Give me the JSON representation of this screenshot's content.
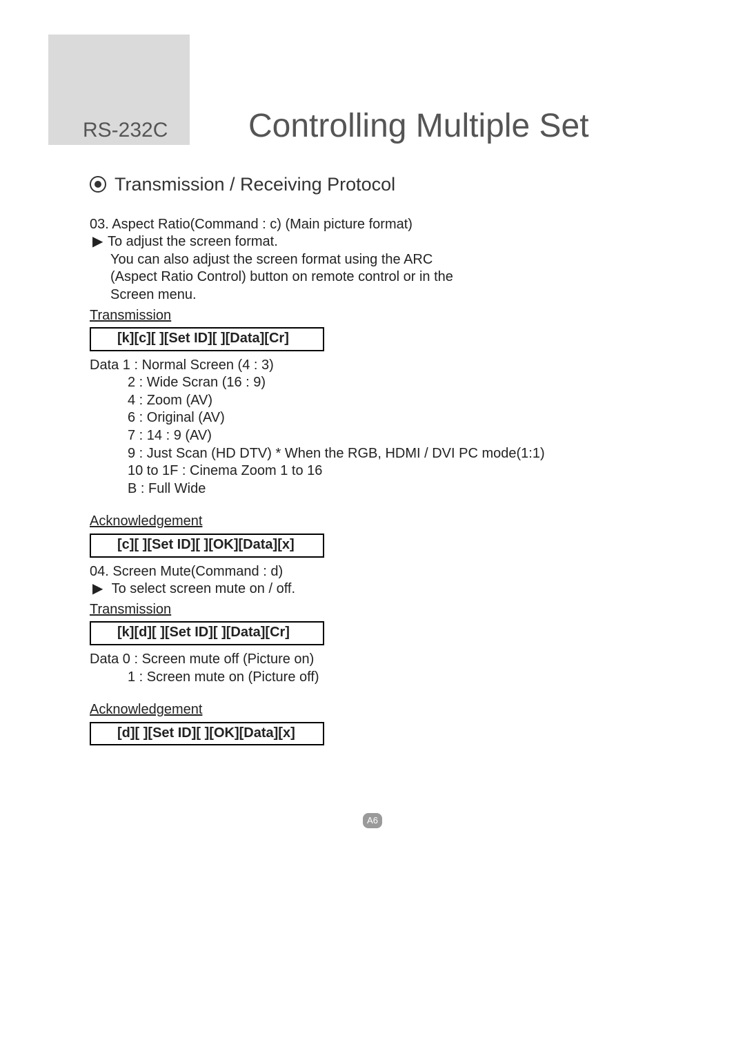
{
  "header": {
    "small": "RS-232C",
    "large": "Controlling Multiple Set"
  },
  "section_title": "Transmission / Receiving Protocol",
  "cmd03": {
    "heading": "03. Aspect Ratio(Command : c) (Main picture format)",
    "arrow_line": "To adjust the screen format.",
    "desc1": "You can also adjust the screen format using the ARC",
    "desc2": "(Aspect Ratio Control) button on remote control or in the",
    "desc3": "Screen menu.",
    "transmission_label": "Transmission",
    "transmission_code": "[k][c][ ][Set ID][ ][Data][Cr]",
    "data_first": "Data 1 : Normal Screen (4 : 3)",
    "data_lines": [
      "2 : Wide Scran (16 : 9)",
      "4 : Zoom (AV)",
      "6 : Original (AV)",
      "7 : 14 : 9 (AV)",
      "9 : Just Scan (HD DTV)   * When the RGB, HDMI / DVI PC mode(1:1)",
      "10 to 1F : Cinema Zoom 1 to 16",
      "B : Full Wide"
    ],
    "ack_label": "Acknowledgement",
    "ack_code": "[c][ ][Set ID][ ][OK][Data][x]"
  },
  "cmd04": {
    "heading": "04. Screen Mute(Command : d)",
    "arrow_line": "To select screen mute on / off.",
    "transmission_label": "Transmission",
    "transmission_code": "[k][d][ ][Set ID][ ][Data][Cr]",
    "data_first": "Data 0 : Screen mute off (Picture on)",
    "data_lines": [
      "1 : Screen mute on (Picture off)"
    ],
    "ack_label": "Acknowledgement",
    "ack_code": "[d][ ][Set ID][ ][OK][Data][x]"
  },
  "page_number": "A6",
  "arrow_symbol": "▶"
}
